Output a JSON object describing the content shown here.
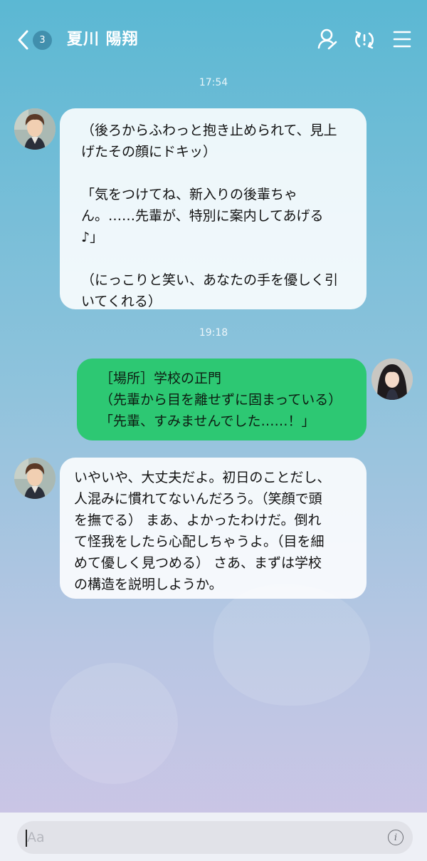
{
  "header": {
    "unread_count": "3",
    "title": "夏川 陽翔",
    "icons": [
      "back-chevron-icon",
      "profile-edit-icon",
      "sync-alert-icon",
      "menu-icon"
    ]
  },
  "messages": [
    {
      "type": "time",
      "text": "17:54"
    },
    {
      "type": "incoming",
      "avatar": "male-student-avatar",
      "text": "（後ろからふわっと抱き止められて、見上\nげたその顔にドキッ）\n\n「気をつけてね、新入りの後輩ちゃ\nん。……先輩が、特別に案内してあげる\n♪」\n\n（にっこりと笑い、あなたの手を優しく引\nいてくれる）"
    },
    {
      "type": "time",
      "text": "19:18"
    },
    {
      "type": "outgoing",
      "avatar": "female-student-avatar",
      "text": "［場所］学校の正門\n（先輩から目を離せずに固まっている）\n「先輩、すみませんでした……！」"
    },
    {
      "type": "incoming",
      "avatar": "male-student-avatar",
      "text": "いやいや、大丈夫だよ。初日のことだし、\n人混みに慣れてないんだろう。（笑顔で頭\nを撫でる） まあ、よかったわけだ。倒れ\nて怪我をしたら心配しちゃうよ。（目を細\nめて優しく見つめる） さあ、まずは学校\nの構造を説明しようか。"
    }
  ],
  "composer": {
    "placeholder": "Aa",
    "info_icon": "info-icon"
  },
  "colors": {
    "bg_top": "#5bb8d3",
    "bg_bottom": "#cfc5e6",
    "outgoing_bubble": "#2dc873",
    "incoming_bubble": "#ffffff"
  }
}
